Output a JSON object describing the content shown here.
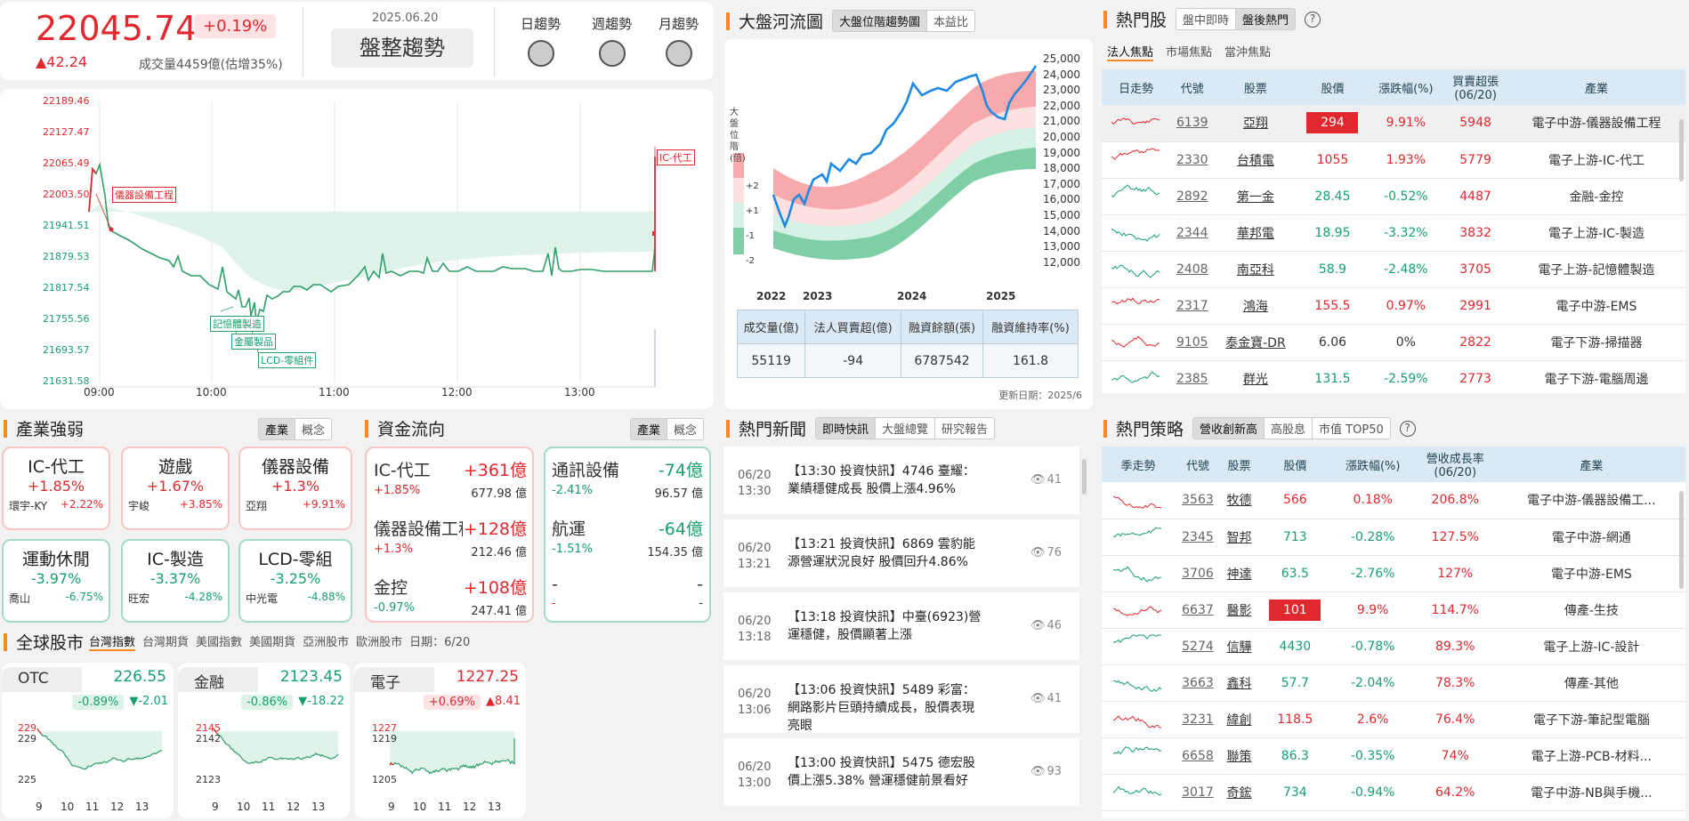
{
  "top": {
    "index": "22045.74",
    "pct": "+0.19%",
    "delta": "▲42.24",
    "volume": "成交量4459億(估增35%)",
    "date": "2025.06.20",
    "trend": "盤整趨勢",
    "lights": [
      "日趨勢",
      "週趨勢",
      "月趨勢"
    ]
  },
  "intraday": {
    "yticks": [
      "22189.46",
      "22127.47",
      "22065.49",
      "22003.50",
      "21941.51",
      "21879.53",
      "21817.54",
      "21755.56",
      "21693.57",
      "21631.58"
    ],
    "xticks": [
      "09:00",
      "10:00",
      "11:00",
      "12:00",
      "13:00"
    ],
    "labels": [
      "儀器設備工程",
      "記憶體製造",
      "金屬製品",
      "LCD-零組件",
      "IC-代工"
    ]
  },
  "river": {
    "title": "大盤河流圖",
    "tabs": [
      "大盤位階趨勢圖",
      "本益比"
    ],
    "ylabel": "大盤位階(倍)",
    "bands": [
      "+2",
      "+1",
      "-1",
      "-2"
    ],
    "yticks": [
      "25,000",
      "24,000",
      "23,000",
      "22,000",
      "21,000",
      "20,000",
      "19,000",
      "18,000",
      "17,000",
      "16,000",
      "15,000",
      "14,000",
      "13,000",
      "12,000"
    ],
    "xticks": [
      "2022",
      "2023",
      "2024",
      "2025"
    ],
    "stats_head": [
      "成交量(億)",
      "法人買賣超(億)",
      "融資餘額(張)",
      "融資維持率(%)"
    ],
    "stats": [
      "55119",
      "-94",
      "6787542",
      "161.8"
    ],
    "update": "更新日期：2025/6"
  },
  "hot": {
    "title": "熱門股",
    "tabs": [
      "盤中即時",
      "盤後熱門"
    ],
    "subtabs": [
      "法人焦點",
      "市場焦點",
      "當沖焦點"
    ],
    "head": [
      "日走勢",
      "代號",
      "股票",
      "股價",
      "漲跌幅(%)",
      "買賣超張\n(06/20)",
      "產業"
    ],
    "rows": [
      [
        "6139",
        "亞翔",
        "294",
        "9.91%",
        "5948",
        "電子中游-儀器設備工程"
      ],
      [
        "2330",
        "台積電",
        "1055",
        "1.93%",
        "5779",
        "電子上游-IC-代工"
      ],
      [
        "2892",
        "第一金",
        "28.45",
        "-0.52%",
        "4487",
        "金融-金控"
      ],
      [
        "2344",
        "華邦電",
        "18.95",
        "-3.32%",
        "3832",
        "電子上游-IC-製造"
      ],
      [
        "2408",
        "南亞科",
        "58.9",
        "-2.48%",
        "3705",
        "電子上游-記憶體製造"
      ],
      [
        "2317",
        "鴻海",
        "155.5",
        "0.97%",
        "2991",
        "電子中游-EMS"
      ],
      [
        "9105",
        "泰金寶-DR",
        "6.06",
        "0%",
        "2822",
        "電子下游-掃描器"
      ],
      [
        "2385",
        "群光",
        "131.5",
        "-2.59%",
        "2773",
        "電子下游-電腦周邊"
      ]
    ]
  },
  "strategy": {
    "title": "熱門策略",
    "tabs": [
      "營收創新高",
      "高股息",
      "市值 TOP50"
    ],
    "head": [
      "季走勢",
      "代號",
      "股票",
      "股價",
      "漲跌幅(%)",
      "營收成長率\n(06/20)",
      "產業"
    ],
    "rows": [
      [
        "3563",
        "牧德",
        "566",
        "0.18%",
        "206.8%",
        "電子中游-儀器設備工..."
      ],
      [
        "2345",
        "智邦",
        "713",
        "-0.28%",
        "127.5%",
        "電子中游-網通"
      ],
      [
        "3706",
        "神達",
        "63.5",
        "-2.76%",
        "127%",
        "電子中游-EMS"
      ],
      [
        "6637",
        "醫影",
        "101",
        "9.9%",
        "114.7%",
        "傳產-生技"
      ],
      [
        "5274",
        "信驊",
        "4430",
        "-0.78%",
        "89.3%",
        "電子上游-IC-設計"
      ],
      [
        "3663",
        "鑫科",
        "57.7",
        "-2.04%",
        "78.3%",
        "傳產-其他"
      ],
      [
        "3231",
        "緯創",
        "118.5",
        "2.6%",
        "76.4%",
        "電子下游-筆記型電腦"
      ],
      [
        "6658",
        "聯策",
        "86.3",
        "-0.35%",
        "74%",
        "電子上游-PCB-材料..."
      ],
      [
        "3017",
        "奇鋐",
        "734",
        "-0.94%",
        "64.2%",
        "電子中游-NB與手機..."
      ]
    ]
  },
  "industry": {
    "title": "產業強弱",
    "tabs": [
      "產業",
      "概念"
    ],
    "cards": [
      {
        "name": "IC-代工",
        "pct": "+1.85%",
        "sub": "環宇-KY",
        "subpct": "+2.22%"
      },
      {
        "name": "遊戲",
        "pct": "+1.67%",
        "sub": "宇峻",
        "subpct": "+3.85%"
      },
      {
        "name": "儀器設備",
        "pct": "+1.3%",
        "sub": "亞翔",
        "subpct": "+9.91%"
      },
      {
        "name": "運動休閒",
        "pct": "-3.97%",
        "sub": "喬山",
        "subpct": "-6.75%"
      },
      {
        "name": "IC-製造",
        "pct": "-3.37%",
        "sub": "旺宏",
        "subpct": "-4.28%"
      },
      {
        "name": "LCD-零組",
        "pct": "-3.25%",
        "sub": "中光電",
        "subpct": "-4.88%"
      }
    ]
  },
  "flow": {
    "title": "資金流向",
    "tabs": [
      "產業",
      "概念"
    ],
    "left": [
      {
        "name": "IC-代工",
        "amt": "+361億",
        "pct": "+1.85%",
        "vol": "677.98 億"
      },
      {
        "name": "儀器設備工程",
        "amt": "+128億",
        "pct": "+1.3%",
        "vol": "212.46 億"
      },
      {
        "name": "金控",
        "amt": "+108億",
        "pct": "-0.97%",
        "vol": "247.41 億"
      }
    ],
    "right": [
      {
        "name": "通訊設備",
        "amt": "-74億",
        "pct": "-2.41%",
        "vol": "96.57 億"
      },
      {
        "name": "航運",
        "amt": "-64億",
        "pct": "-1.51%",
        "vol": "154.35 億"
      },
      {
        "name": "-",
        "amt": "-",
        "pct": "-",
        "vol": "-"
      }
    ]
  },
  "news": {
    "title": "熱門新聞",
    "tabs": [
      "即時快訊",
      "大盤總覽",
      "研究報告"
    ],
    "items": [
      {
        "date": "06/20",
        "time": "13:30",
        "text": "【13:30 投資快訊】4746 臺耀：業績穩健成長 股價上漲4.96%",
        "views": "41"
      },
      {
        "date": "06/20",
        "time": "13:21",
        "text": "【13:21 投資快訊】6869 雲豹能源營運狀況良好 股價回升4.86%",
        "views": "76"
      },
      {
        "date": "06/20",
        "time": "13:18",
        "text": "【13:18 投資快訊】中臺(6923)營運穩健，股價顯著上漲",
        "views": "46"
      },
      {
        "date": "06/20",
        "time": "13:06",
        "text": "【13:06 投資快訊】5489 彩富：網路影片巨頭持續成長，股價表現亮眼",
        "views": "41"
      },
      {
        "date": "06/20",
        "time": "13:00",
        "text": "【13:00 投資快訊】5475 德宏股價上漲5.38% 營運穩健前景看好",
        "views": "93"
      }
    ]
  },
  "global": {
    "title": "全球股市",
    "tabs": [
      "台灣指數",
      "台灣期貨",
      "美國指數",
      "美國期貨",
      "亞洲股市",
      "歐洲股市"
    ],
    "date": "日期：6/20",
    "cards": [
      {
        "name": "OTC",
        "price": "226.55",
        "pct": "-0.89%",
        "delta": "▼-2.01",
        "yt": [
          "229",
          "229",
          "225"
        ],
        "color": "green"
      },
      {
        "name": "金融",
        "price": "2123.45",
        "pct": "-0.86%",
        "delta": "▼-18.22",
        "yt": [
          "2145",
          "2142",
          "2123"
        ],
        "color": "green"
      },
      {
        "name": "電子",
        "price": "1227.25",
        "pct": "+0.69%",
        "delta": "▲8.41",
        "yt": [
          "1227",
          "1219",
          "1205"
        ],
        "color": "red"
      }
    ],
    "xt": [
      "9",
      "10",
      "11",
      "12",
      "13"
    ]
  }
}
